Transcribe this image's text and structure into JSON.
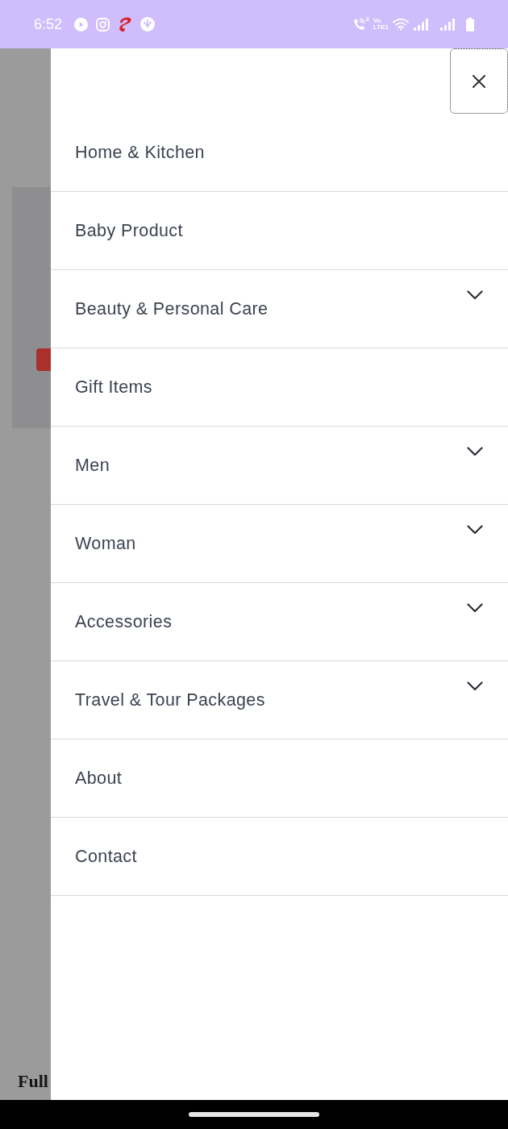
{
  "status_bar": {
    "time": "6:52",
    "call_badge": "2",
    "network_label": [
      "Vo",
      "LTE1"
    ]
  },
  "background_page": {
    "caption": "Full"
  },
  "drawer": {
    "items": [
      {
        "label": "Home & Kitchen",
        "has_submenu": false
      },
      {
        "label": "Baby Product",
        "has_submenu": false
      },
      {
        "label": "Beauty & Personal Care",
        "has_submenu": true
      },
      {
        "label": "Gift Items",
        "has_submenu": false
      },
      {
        "label": "Men",
        "has_submenu": true
      },
      {
        "label": "Woman",
        "has_submenu": true
      },
      {
        "label": "Accessories",
        "has_submenu": true
      },
      {
        "label": "Travel & Tour Packages",
        "has_submenu": true
      },
      {
        "label": "About",
        "has_submenu": false
      },
      {
        "label": "Contact",
        "has_submenu": false
      }
    ]
  }
}
